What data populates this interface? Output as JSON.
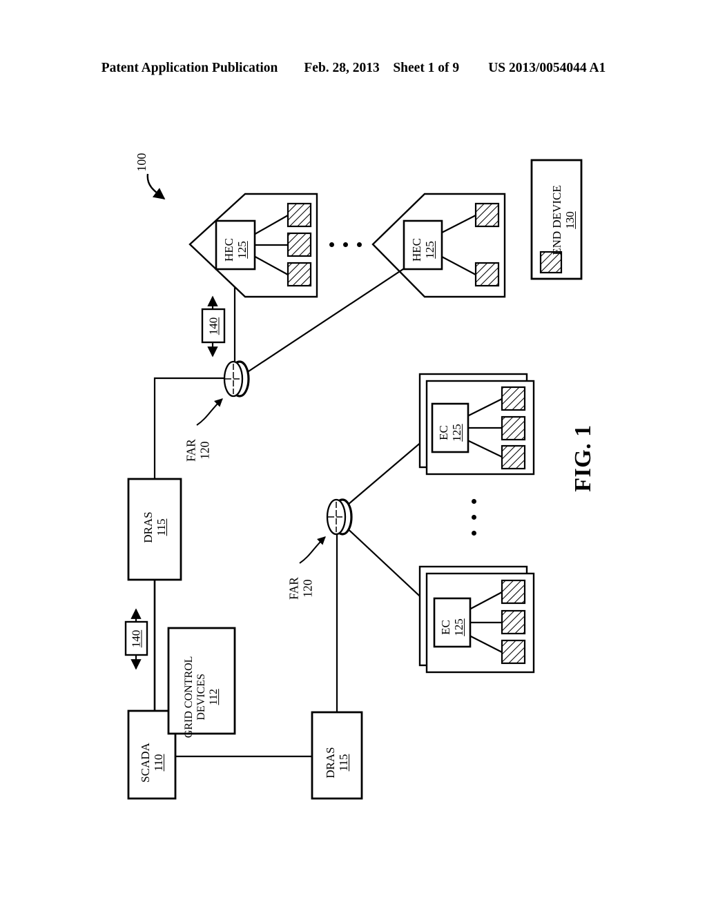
{
  "header": {
    "left": "Patent Application Publication",
    "date": "Feb. 28, 2013",
    "sheet": "Sheet 1 of 9",
    "patent_number": "US 2013/0054044 A1"
  },
  "figure": {
    "caption": "FIG. 1",
    "system_ref": "100",
    "legend": {
      "label": "END DEVICE",
      "ref": "130",
      "swatch": "hatched-square"
    },
    "nodes": {
      "scada": {
        "label": "SCADA",
        "ref": "110"
      },
      "grid_control": {
        "label_line1": "GRID CONTROL",
        "label_line2": "DEVICES",
        "ref": "112"
      },
      "dras_upper": {
        "label": "DRAS",
        "ref": "115"
      },
      "dras_lower": {
        "label": "DRAS",
        "ref": "115"
      },
      "far_upper": {
        "label": "FAR",
        "ref": "120"
      },
      "far_lower": {
        "label": "FAR",
        "ref": "120"
      },
      "hec_1": {
        "label": "HEC",
        "ref": "125"
      },
      "hec_2": {
        "label": "HEC",
        "ref": "125"
      },
      "ec_1": {
        "label": "EC",
        "ref": "125"
      },
      "ec_2": {
        "label": "EC",
        "ref": "125"
      },
      "link_upper": {
        "ref": "140"
      },
      "link_lower": {
        "ref": "140"
      }
    },
    "ellipsis": {
      "houses": "• • •",
      "clusters": "• • •"
    },
    "end_device_counts": {
      "hec_1": 3,
      "hec_2": 2,
      "ec_1": 3,
      "ec_2": 3
    },
    "colors": {
      "line": "#000000",
      "background": "#ffffff"
    }
  }
}
